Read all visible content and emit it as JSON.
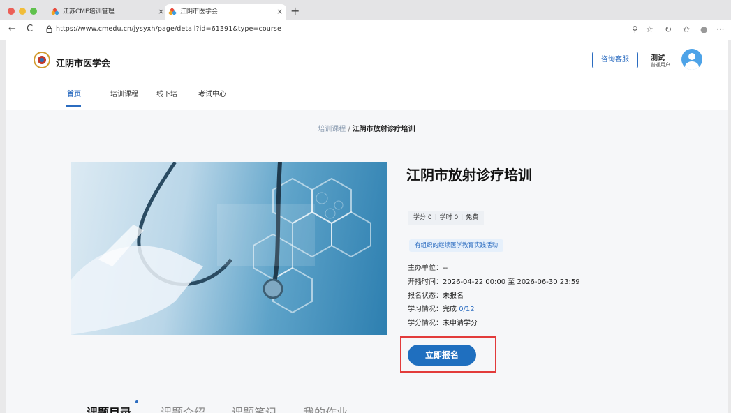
{
  "browser": {
    "tabs": [
      {
        "label": "江苏CME培训管理",
        "close": "×"
      },
      {
        "label": "江阴市医学会",
        "close": "×"
      }
    ],
    "new_tab": "+",
    "url": "https://www.cmedu.cn/jysyxh/page/detail?id=61391&type=course",
    "nav": {
      "back": "←",
      "reload": "C"
    },
    "toolbar_icons": [
      "key-icon",
      "star-icon",
      "refresh-icon",
      "favorites-icon",
      "profile-icon",
      "more-icon"
    ],
    "toolbar_glyphs": {
      "key": "⚲",
      "star": "☆",
      "refresh": "↻",
      "favorites": "✩",
      "profile": "●",
      "more": "···"
    }
  },
  "site": {
    "name": "江阴市医学会",
    "consult_button": "咨询客服",
    "user": {
      "name": "测试",
      "role": "普通用户"
    },
    "nav": [
      "首页",
      "培训课程",
      "线下培",
      "考试中心"
    ]
  },
  "breadcrumb": {
    "parent": "培训课程",
    "separator": "/",
    "current": "江阴市放射诊疗培训"
  },
  "course": {
    "title": "江阴市放射诊疗培训",
    "stats": [
      "学分 0",
      "学时 0",
      "免费"
    ],
    "tag": "有组织的继续医学教育实践活动",
    "info": [
      {
        "key": "主办单位：",
        "value": "--"
      },
      {
        "key": "开播时间：",
        "value": "2026-04-22 00:00 至 2026-06-30 23:59"
      },
      {
        "key": "报名状态：",
        "value": "未报名"
      },
      {
        "key": "学习情况：",
        "value": "完成 ",
        "highlight": "0/12"
      },
      {
        "key": "学分情况：",
        "value": "未申请学分"
      }
    ],
    "enroll_button": "立即报名"
  },
  "bottom_tabs": [
    "课题目录",
    "课题介绍",
    "课题笔记",
    "我的作业"
  ],
  "colors": {
    "accent": "#2b6cc0",
    "button": "#1f6fbf",
    "highlight_box": "#e23b3b"
  }
}
